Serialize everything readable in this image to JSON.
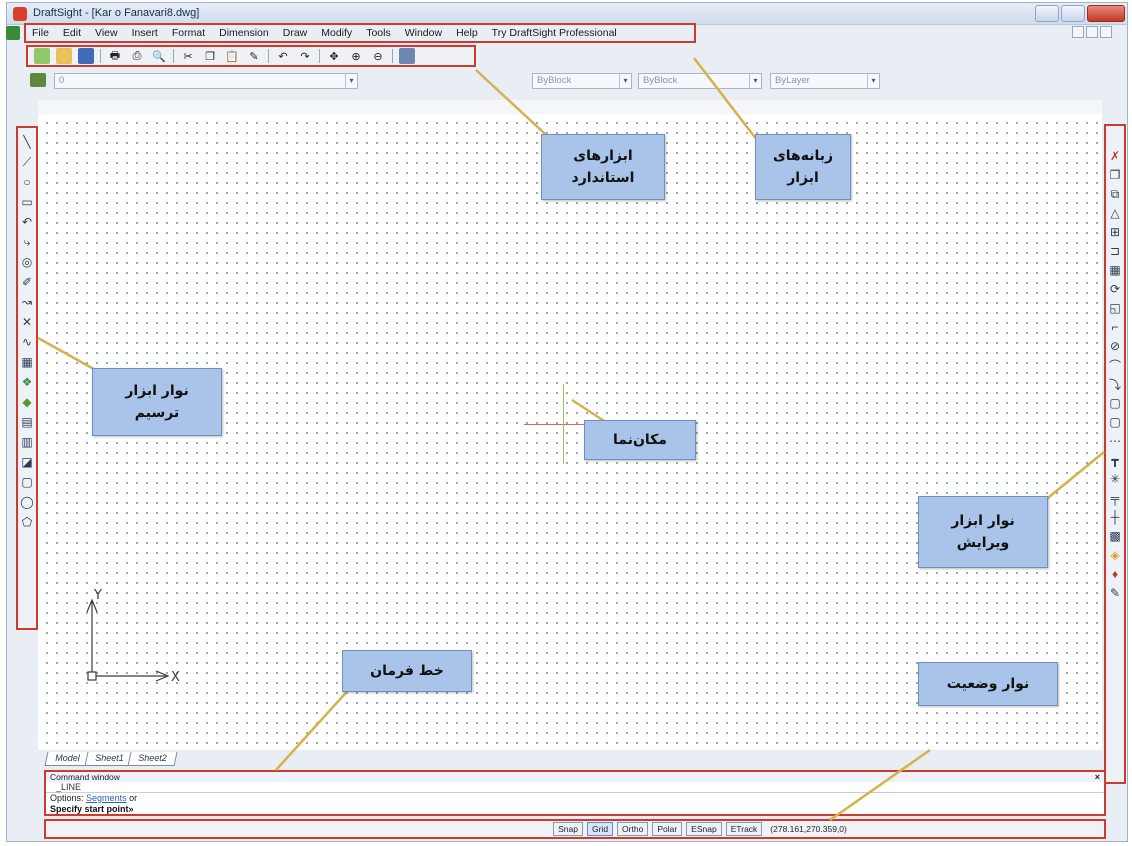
{
  "window": {
    "title": "DraftSight - [Kar o Fanavari8.dwg]"
  },
  "menu": {
    "items": [
      "File",
      "Edit",
      "View",
      "Insert",
      "Format",
      "Dimension",
      "Draw",
      "Modify",
      "Tools",
      "Window",
      "Help",
      "Try DraftSight Professional"
    ]
  },
  "toolbar_standard": {
    "buttons": [
      "new-icon",
      "open-icon",
      "save-icon",
      "print-icon",
      "print-preview-icon",
      "zoom-preview-icon",
      "cut-icon",
      "copy-icon",
      "paste-icon",
      "match-properties-icon",
      "undo-icon",
      "redo-icon",
      "pan-icon",
      "zoom-window-icon",
      "zoom-realtime-icon",
      "layout-icon"
    ]
  },
  "propbar": {
    "layer_value": "0",
    "color_value": "ByBlock",
    "linestyle_value": "ByBlock",
    "lineweight_value": "ByLayer"
  },
  "tabs": [
    "Model",
    "Sheet1",
    "Sheet2"
  ],
  "command": {
    "title": "Command window",
    "close": "×",
    "line": "_LINE",
    "options_prefix": "Options:",
    "options_link": "Segments",
    "options_suffix": "or",
    "prompt": "Specify start point»"
  },
  "statusbar": {
    "buttons": [
      "Snap",
      "Grid",
      "Ortho",
      "Polar",
      "ESnap",
      "ETrack"
    ],
    "active": [
      "Grid"
    ],
    "coords": "(278.161,270.359,0)"
  },
  "ucs": {
    "x_label": "X",
    "y_label": "Y"
  },
  "callouts": {
    "standard_tools": "ابزارهای\nاستاندارد",
    "menus": "زبانه‌های\nابزار",
    "draw_toolbar": "نوار ابزار\nترسیم",
    "cursor": "مکان‌نما",
    "edit_toolbar": "نوار ابزار\nویرایش",
    "command_line": "خط فرمان",
    "status_bar": "نوار وضعیت"
  },
  "colors": {
    "highlight_border": "#d03a2e",
    "callout_fill": "#a9c3e9",
    "leader_line": "#d4b24c"
  }
}
